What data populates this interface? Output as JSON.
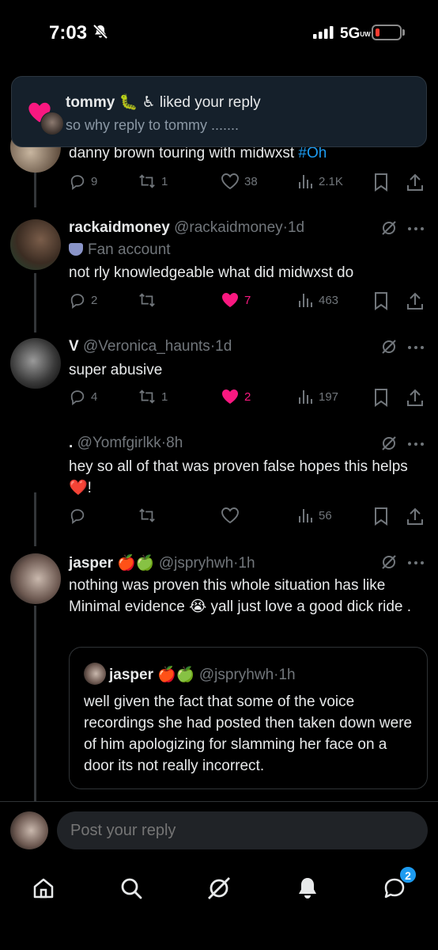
{
  "status_bar": {
    "time": "7:03",
    "network": "5G",
    "network_sub": "UW"
  },
  "notification": {
    "user": "tommy",
    "emoji": "🐛 ♿",
    "action": "liked your reply",
    "preview": "so why reply to tommy ......."
  },
  "tweets": [
    {
      "partial_text": "danny brown touring with midwxst ",
      "hashtag": "#Oh",
      "replies": "9",
      "retweets": "1",
      "likes": "38",
      "views": "2.1K",
      "liked": false
    },
    {
      "name": "rackaidmoney",
      "handle": "@rackaidmoney",
      "time": "1d",
      "fan_label": "Fan account",
      "text": "not rly knowledgeable what did midwxst do",
      "replies": "2",
      "retweets": "",
      "likes": "7",
      "views": "463",
      "liked": true
    },
    {
      "name": "V",
      "handle": "@Veronica_haunts",
      "time": "1d",
      "text": "super abusive",
      "replies": "4",
      "retweets": "1",
      "likes": "2",
      "views": "197",
      "liked": true
    },
    {
      "name": ".",
      "handle": "@Yomfgirlkk",
      "time": "8h",
      "text": "hey so all of that was proven false hopes this helps ❤️!",
      "replies": "",
      "retweets": "",
      "likes": "",
      "views": "56",
      "liked": false
    },
    {
      "name": "jasper",
      "emoji": "🍎🍏",
      "handle": "@jspryhwh",
      "time": "1h",
      "text": "nothing was proven this whole situation has like Minimal evidence 😭 yall just love a good dick ride .",
      "quote": {
        "name": "jasper",
        "emoji": "🍎🍏",
        "handle": "@jspryhwh",
        "time": "1h",
        "text": "well given the fact that some of the voice recordings she had posted then taken down were of him apologizing for slamming her face on a door its not really incorrect."
      }
    }
  ],
  "reply_bar": {
    "placeholder": "Post your reply"
  },
  "tabbar": {
    "messages_badge": "2"
  },
  "icons": [
    "bell-off-icon",
    "signal-icon",
    "battery-icon",
    "heart-icon",
    "reply-icon",
    "retweet-icon",
    "views-icon",
    "bookmark-icon",
    "share-icon",
    "grok-icon",
    "more-icon",
    "mask-icon",
    "home-icon",
    "search-icon",
    "grok-tab-icon",
    "notifications-icon",
    "messages-icon"
  ],
  "colors": {
    "background": "#000000",
    "like": "#f91880",
    "link": "#1d9bf0",
    "muted": "#71767b",
    "notification_bg": "#15202b"
  }
}
